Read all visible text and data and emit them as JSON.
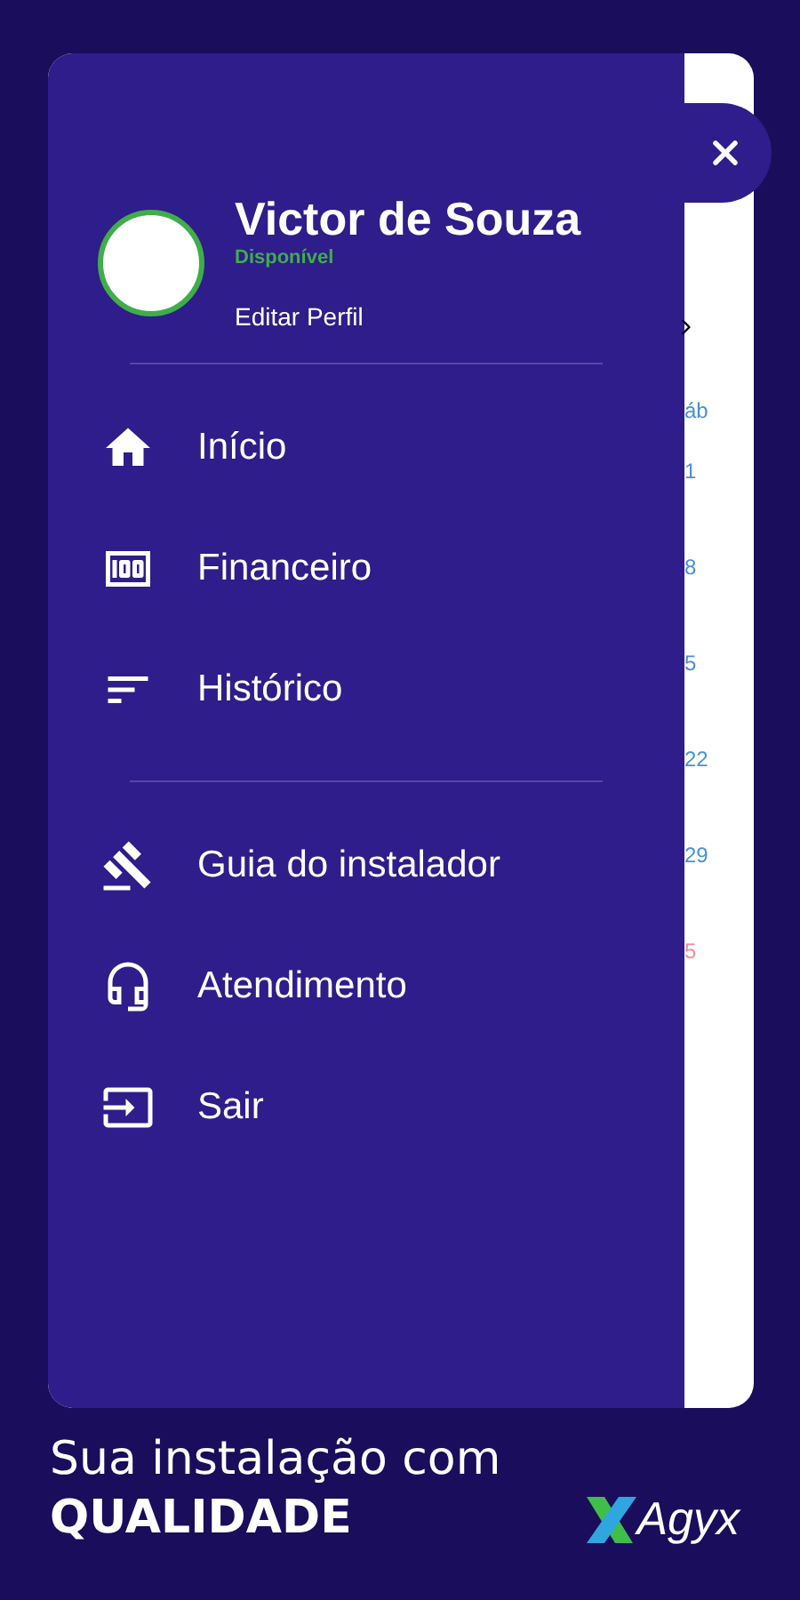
{
  "profile": {
    "name": "Victor de Souza",
    "status": "Disponível",
    "edit_label": "Editar Perfil"
  },
  "menu_groups": [
    [
      {
        "label": "Início"
      },
      {
        "label": "Financeiro"
      },
      {
        "label": "Histórico"
      }
    ],
    [
      {
        "label": "Guia do instalador"
      },
      {
        "label": "Atendimento"
      },
      {
        "label": "Sair"
      }
    ]
  ],
  "calendar_fragments": [
    {
      "text": "áb",
      "color": "#4a8fd8"
    },
    {
      "text": "1",
      "color": "#4a8fd8"
    },
    {
      "text": "8",
      "color": "#4a8fd8"
    },
    {
      "text": "5",
      "color": "#4a8fd8"
    },
    {
      "text": "22",
      "color": "#4a8fd8"
    },
    {
      "text": "29",
      "color": "#4a8fd8"
    },
    {
      "text": "5",
      "color": "#f08a9a"
    }
  ],
  "footer": {
    "tagline": "Sua instalação com",
    "emphasis": "QUALIDADE",
    "logo_text": "Agyx"
  }
}
